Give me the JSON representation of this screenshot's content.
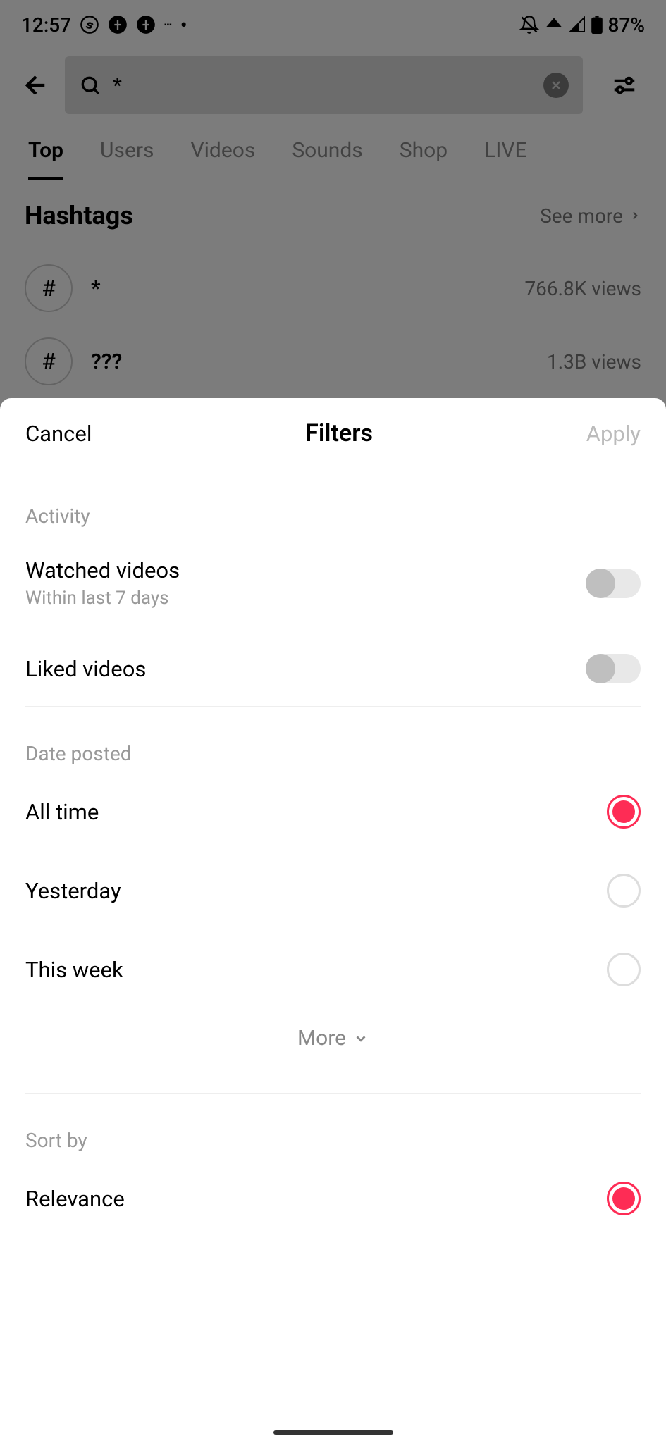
{
  "status": {
    "time": "12:57",
    "battery": "87%"
  },
  "search": {
    "query": "*"
  },
  "tabs": [
    "Top",
    "Users",
    "Videos",
    "Sounds",
    "Shop",
    "LIVE"
  ],
  "hashtags": {
    "title": "Hashtags",
    "seeMore": "See more",
    "items": [
      {
        "name": "*",
        "views": "766.8K views"
      },
      {
        "name": "???",
        "views": "1.3B views"
      }
    ]
  },
  "filters": {
    "cancel": "Cancel",
    "title": "Filters",
    "apply": "Apply",
    "activity": {
      "label": "Activity",
      "watched": {
        "label": "Watched videos",
        "sublabel": "Within last 7 days"
      },
      "liked": {
        "label": "Liked videos"
      }
    },
    "datePosted": {
      "label": "Date posted",
      "options": [
        "All time",
        "Yesterday",
        "This week"
      ],
      "more": "More"
    },
    "sortBy": {
      "label": "Sort by",
      "options": [
        "Relevance"
      ]
    }
  }
}
